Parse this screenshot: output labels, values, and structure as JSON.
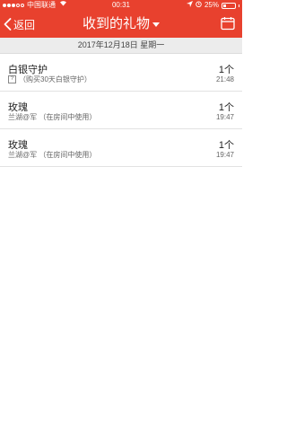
{
  "status_bar": {
    "carrier": "中国联通",
    "time": "00:31",
    "battery": "25%",
    "battery_level": 0.25
  },
  "nav": {
    "back_label": "返回",
    "title": "收到的礼物"
  },
  "date_header": "2017年12月18日 星期一",
  "gifts": [
    {
      "name": "白银守护",
      "detail": "（购买30天白银守护）",
      "detail_icon": "?",
      "count": "1个",
      "time": "21:48"
    },
    {
      "name": "玫瑰",
      "detail": "兰湖@军 （在房间中使用）",
      "count": "1个",
      "time": "19:47"
    },
    {
      "name": "玫瑰",
      "detail": "兰湖@军 （在房间中使用）",
      "count": "1个",
      "time": "19:47"
    }
  ],
  "colors": {
    "header": "#e8412e"
  },
  "icons": [
    "back-chevron-icon",
    "dropdown-caret-icon",
    "calendar-icon",
    "wifi-icon",
    "location-icon",
    "alarm-icon",
    "battery-icon"
  ]
}
